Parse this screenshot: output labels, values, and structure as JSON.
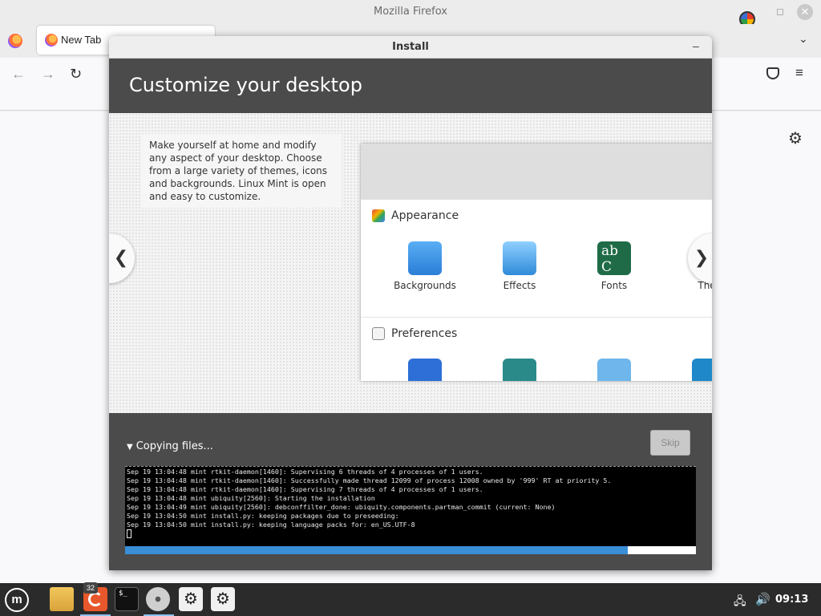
{
  "firefox": {
    "window_title": "Mozilla Firefox",
    "tab_label": "New Tab",
    "min_glyph": "◻",
    "close_glyph": "✕",
    "list_tabs_glyph": "⌄",
    "back_glyph": "←",
    "forward_glyph": "→",
    "reload_glyph": "↻",
    "menu_glyph": "≡",
    "settings_glyph": "⚙"
  },
  "dialog": {
    "title": "Install",
    "minimize_glyph": "‒",
    "slide": {
      "heading": "Customize your desktop",
      "description": "Make yourself at home and modify any aspect of your desktop. Choose from a large variety of themes, icons and backgrounds. Linux Mint is open and easy to customize.",
      "prev_glyph": "❮",
      "next_glyph": "❯",
      "screenshot": {
        "sections": [
          {
            "title": "Appearance"
          },
          {
            "title": "Preferences"
          }
        ],
        "appearance_items": [
          {
            "label": "Backgrounds"
          },
          {
            "label": "Effects"
          },
          {
            "label": "Fonts"
          },
          {
            "label": "Ther"
          }
        ],
        "fonts_icon_text": "ab C"
      }
    },
    "status": {
      "label": "Copying files...",
      "toggle_glyph": "▼"
    },
    "skip_label": "Skip",
    "log_lines": [
      "Sep 19 13:04:48 mint rtkit-daemon[1460]: Supervising 6 threads of 4 processes of 1 users.",
      "Sep 19 13:04:48 mint rtkit-daemon[1460]: Successfully made thread 12099 of process 12008 owned by '999' RT at priority 5.",
      "Sep 19 13:04:48 mint rtkit-daemon[1460]: Supervising 7 threads of 4 processes of 1 users.",
      "Sep 19 13:04:48 mint ubiquity[2560]: Starting the installation",
      "Sep 19 13:04:49 mint ubiquity[2560]: debconffilter_done: ubiquity.components.partman_commit (current: None)",
      "Sep 19 13:04:50 mint install.py: keeping packages due to preseeding:",
      "Sep 19 13:04:50 mint install.py: keeping language packs for: en_US.UTF-8"
    ],
    "progress_percent": 88
  },
  "taskbar": {
    "menu_logo_text": "m",
    "firefox_badge": "32",
    "terminal_glyph": "$_",
    "settings_glyph": "⚙",
    "network_glyph": "🖧",
    "volume_glyph": "🔊",
    "clock": "09:13"
  },
  "colors": {
    "accent": "#3a8ed8",
    "dark_panel": "#4b4b4b",
    "taskbar": "#2b2b2b"
  }
}
